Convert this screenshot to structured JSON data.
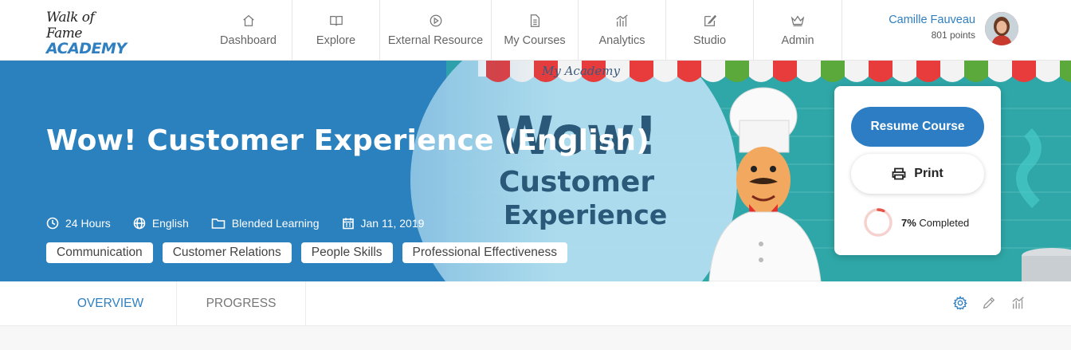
{
  "brand": {
    "line1": "Walk of Fame",
    "line2": "ACADEMY"
  },
  "nav": [
    {
      "label": "Dashboard",
      "icon": "home-icon"
    },
    {
      "label": "Explore",
      "icon": "book-icon"
    },
    {
      "label": "External Resource",
      "icon": "play-circle-icon"
    },
    {
      "label": "My Courses",
      "icon": "document-icon"
    },
    {
      "label": "Analytics",
      "icon": "bar-chart-icon"
    },
    {
      "label": "Studio",
      "icon": "edit-icon"
    },
    {
      "label": "Admin",
      "icon": "crown-icon"
    }
  ],
  "user": {
    "name": "Camille Fauveau",
    "points": "801 points"
  },
  "hero": {
    "title": "Wow! Customer Experience (English)",
    "banner_caption": "My Academy",
    "banner_text": [
      "Wow!",
      "Customer",
      "Experience"
    ],
    "meta": {
      "duration": "24 Hours",
      "language": "English",
      "type": "Blended Learning",
      "date": "Jan 11, 2019"
    },
    "tags": [
      "Communication",
      "Customer Relations",
      "People Skills",
      "Professional Effectiveness"
    ]
  },
  "card": {
    "resume_label": "Resume Course",
    "print_label": "Print",
    "progress_percent": "7%",
    "progress_suffix": "Completed",
    "progress_value": 0.07
  },
  "tabs": {
    "overview": "OVERVIEW",
    "progress": "PROGRESS"
  },
  "colors": {
    "accent": "#2f7fc1",
    "hero": "#2b80be",
    "progress_ring": "#e8534a"
  }
}
